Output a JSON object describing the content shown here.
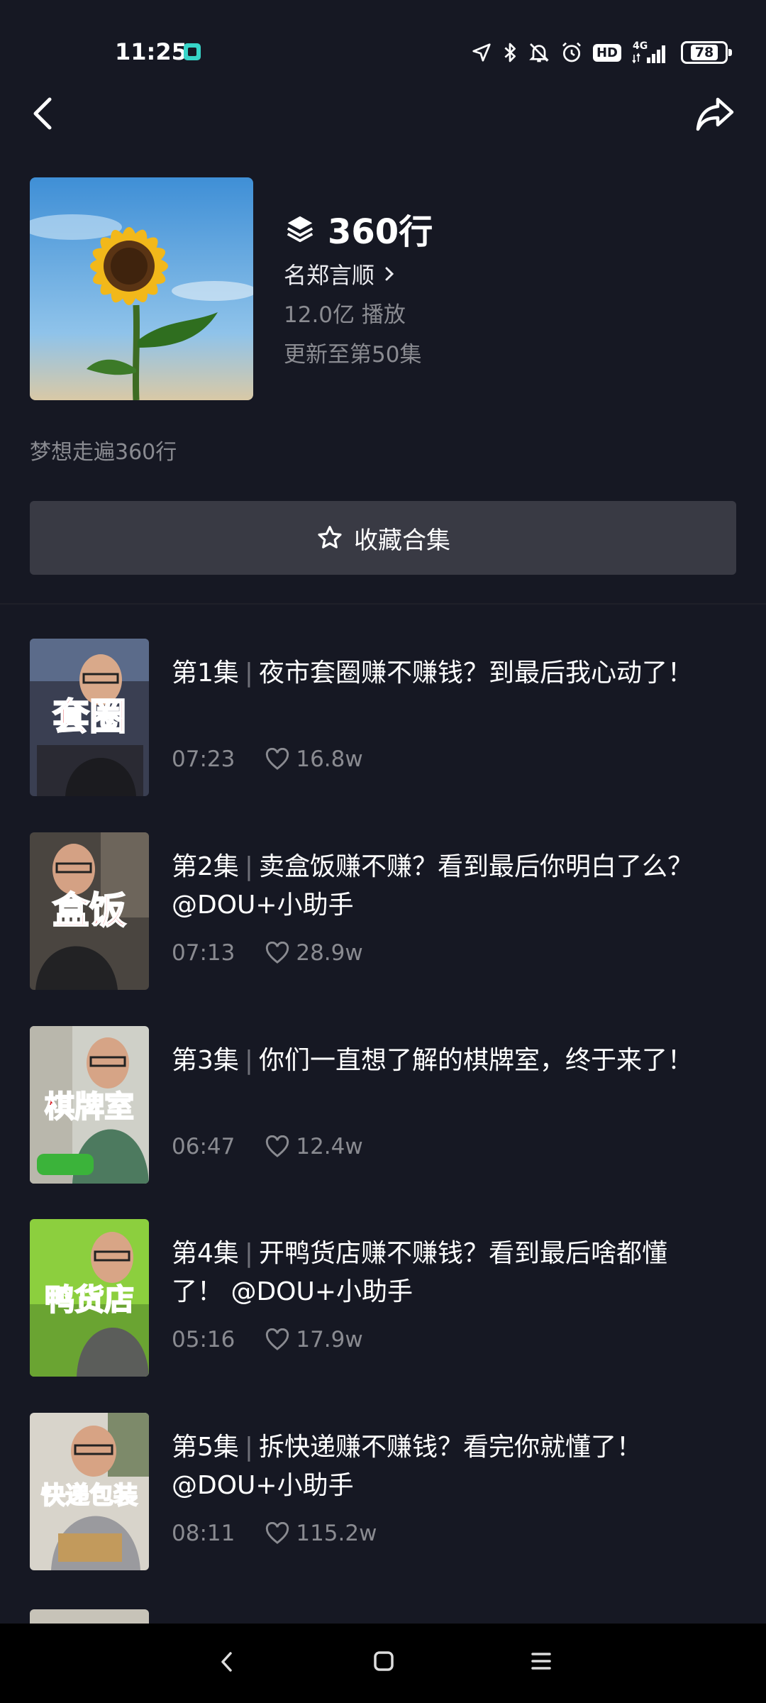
{
  "status_bar": {
    "time": "11:25",
    "network": "4G",
    "battery": "78"
  },
  "collection": {
    "title": "360行",
    "author": "名郑言顺",
    "plays": "12.0亿 播放",
    "update": "更新至第50集",
    "description": "梦想走遍360行",
    "collect_label": "收藏合集"
  },
  "episodes": [
    {
      "num": "第1集",
      "title": "夜市套圈赚不赚钱？到最后我心动了！",
      "duration": "07:23",
      "likes": "16.8w",
      "thumb_text": "套圈"
    },
    {
      "num": "第2集",
      "title": "卖盒饭赚不赚？看到最后你明白了么？@DOU+小助手",
      "duration": "07:13",
      "likes": "28.9w",
      "thumb_text": "盒饭"
    },
    {
      "num": "第3集",
      "title": "你们一直想了解的棋牌室，终于来了！",
      "duration": "06:47",
      "likes": "12.4w",
      "thumb_text": "棋牌室"
    },
    {
      "num": "第4集",
      "title": "开鸭货店赚不赚钱？看到最后啥都懂了！ @DOU+小助手",
      "duration": "05:16",
      "likes": "17.9w",
      "thumb_text": "鸭货店"
    },
    {
      "num": "第5集",
      "title": "拆快递赚不赚钱？看完你就懂了！@DOU+小助手",
      "duration": "08:11",
      "likes": "115.2w",
      "thumb_text": "快递包装"
    }
  ],
  "icons": {
    "back": "chevron-left-icon",
    "share": "share-arrow-icon",
    "collection": "stack-layers-icon",
    "author_link": "chevron-right-icon",
    "collect": "star-icon",
    "like": "heart-icon"
  },
  "colors": {
    "background": "#161823",
    "button": "#393a44",
    "secondary_text": "#8a8b91"
  }
}
